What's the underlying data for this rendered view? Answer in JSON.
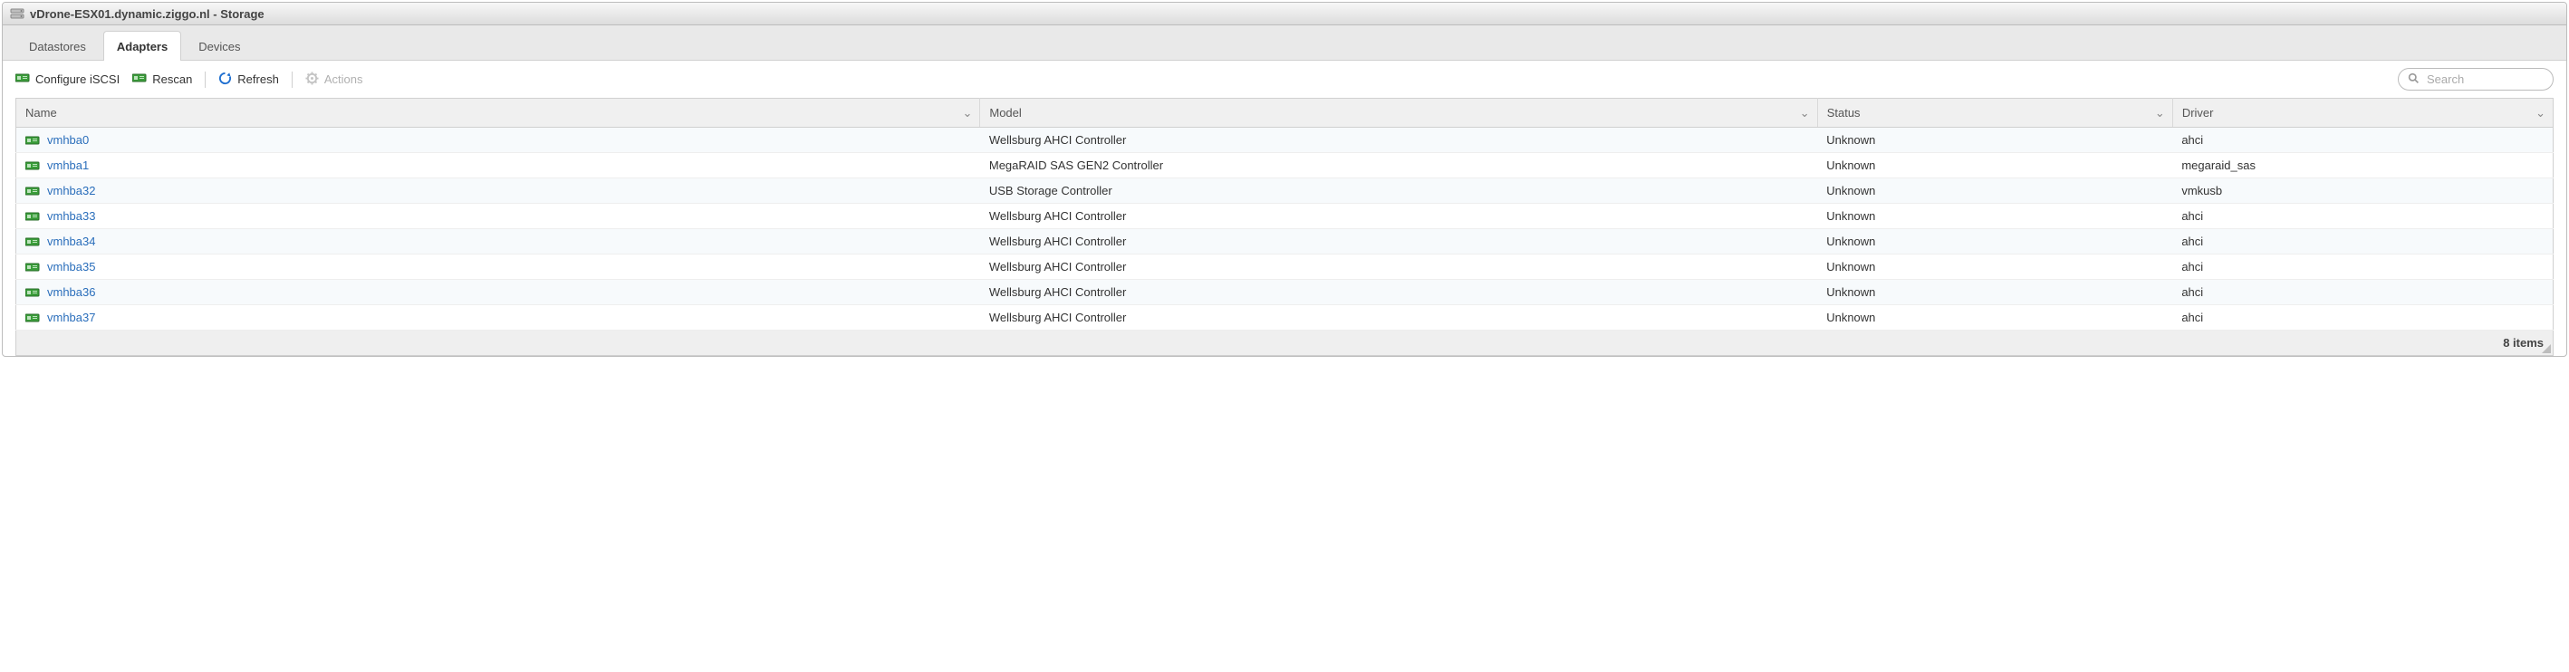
{
  "window": {
    "title": "vDrone-ESX01.dynamic.ziggo.nl - Storage"
  },
  "tabs": {
    "datastores": "Datastores",
    "adapters": "Adapters",
    "devices": "Devices",
    "active": "adapters"
  },
  "toolbar": {
    "configure_iscsi": "Configure iSCSI",
    "rescan": "Rescan",
    "refresh": "Refresh",
    "actions": "Actions"
  },
  "search": {
    "placeholder": "Search",
    "value": ""
  },
  "columns": {
    "name": "Name",
    "model": "Model",
    "status": "Status",
    "driver": "Driver"
  },
  "rows": [
    {
      "name": "vmhba0",
      "model": "Wellsburg AHCI Controller",
      "status": "Unknown",
      "driver": "ahci"
    },
    {
      "name": "vmhba1",
      "model": "MegaRAID SAS GEN2 Controller",
      "status": "Unknown",
      "driver": "megaraid_sas"
    },
    {
      "name": "vmhba32",
      "model": "USB Storage Controller",
      "status": "Unknown",
      "driver": "vmkusb"
    },
    {
      "name": "vmhba33",
      "model": "Wellsburg AHCI Controller",
      "status": "Unknown",
      "driver": "ahci"
    },
    {
      "name": "vmhba34",
      "model": "Wellsburg AHCI Controller",
      "status": "Unknown",
      "driver": "ahci"
    },
    {
      "name": "vmhba35",
      "model": "Wellsburg AHCI Controller",
      "status": "Unknown",
      "driver": "ahci"
    },
    {
      "name": "vmhba36",
      "model": "Wellsburg AHCI Controller",
      "status": "Unknown",
      "driver": "ahci"
    },
    {
      "name": "vmhba37",
      "model": "Wellsburg AHCI Controller",
      "status": "Unknown",
      "driver": "ahci"
    }
  ],
  "footer": {
    "count_text": "8 items"
  }
}
